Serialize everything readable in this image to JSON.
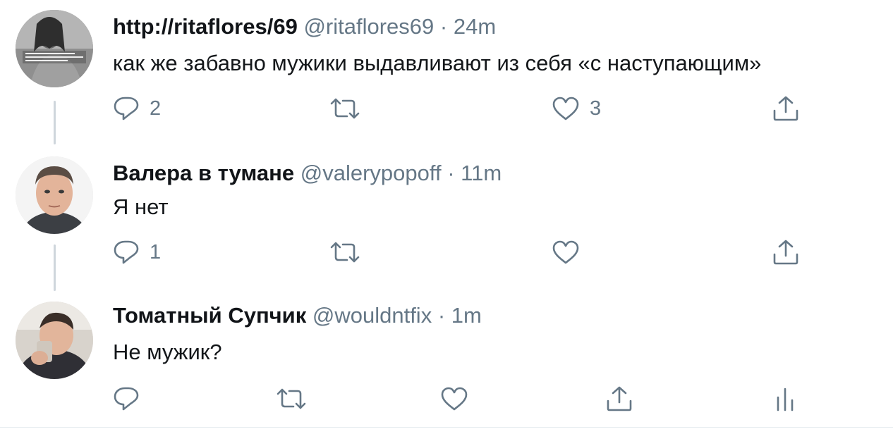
{
  "tweets": [
    {
      "name": "http://ritaflores/69",
      "handle": "@ritaflores69",
      "separator": "·",
      "time": "24m",
      "text": "как же забавно мужики выдавливают из себя «с наступающим»",
      "reply_count": "2",
      "retweet_count": "",
      "like_count": "3",
      "avatar_icon": "woman-bw-photo-avatar"
    },
    {
      "name": "Валера в тумане",
      "handle": "@valerypopoff",
      "separator": "·",
      "time": "11m",
      "text": "Я нет",
      "reply_count": "1",
      "retweet_count": "",
      "like_count": "",
      "avatar_icon": "man-portrait-avatar"
    },
    {
      "name": "Томатный Супчик",
      "handle": "@wouldntfix",
      "separator": "·",
      "time": "1m",
      "text": "Не мужик?",
      "reply_count": "",
      "retweet_count": "",
      "like_count": "",
      "avatar_icon": "young-man-drinking-avatar"
    }
  ],
  "colors": {
    "icon_gray": "#657786",
    "thread_line": "#cfd6dc",
    "text": "#14171a"
  }
}
